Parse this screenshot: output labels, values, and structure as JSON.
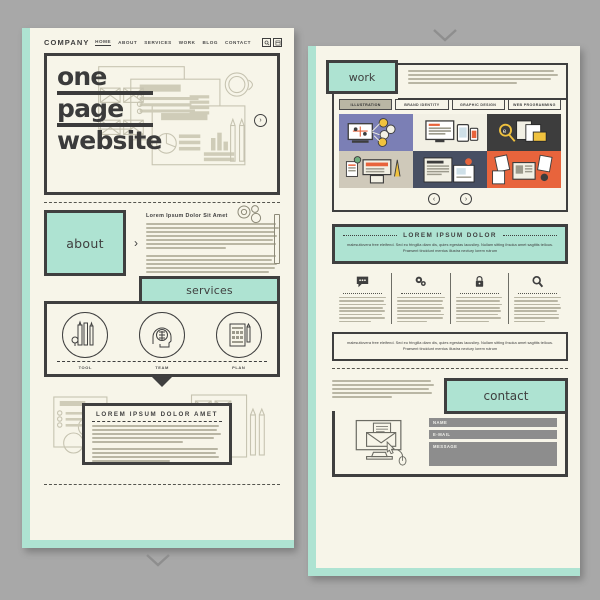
{
  "meta": {
    "bg_color": "#a8a8a8",
    "paper_color": "#f7f5e9",
    "mint_color": "#aee3d2",
    "ink_color": "#3f3f3f"
  },
  "left_page": {
    "header": {
      "brand": "COMPANY",
      "nav": [
        {
          "label": "HOME",
          "active": true
        },
        {
          "label": "ABOUT",
          "active": false
        },
        {
          "label": "SERVICES",
          "active": false
        },
        {
          "label": "WORK",
          "active": false
        },
        {
          "label": "BLOG",
          "active": false
        },
        {
          "label": "CONTACT",
          "active": false
        }
      ],
      "buttons": [
        "search-icon",
        "menu-icon"
      ]
    },
    "hero": {
      "line1": "one",
      "line2": "page",
      "line3": "website",
      "next_label": "›"
    },
    "about": {
      "tab_label": "about",
      "arrow": "›",
      "heading": "Lorem Ipsum Dolor Sit Amet",
      "paragraph1": "Lorem ipsum dolor sit amet, consectetur adipiscing elit. Donec fringilla rhoncus urna eleifend elementum. Sed eu fringilla diam dis, quam egestas lacus nec sagittis tellus. Praesent tincidunt mentus lectus nunc nunc dolore lorem rutrum. Aliquam suscipit. Curabitur eget porttitor elit eu fringilla diam, quis egestas lacus nec sagittis.",
      "paragraph2": "Lorem ipsum dolor sit amet, consectetur adipiscing elit, Donec fringilla rutrum ut viverra diam. Sed eu fringilla diam dis, quam egestas lacus nec sagittis. Praesent tincidunt mentus lectus nunc quam egestas lacus nec sagittis tellus."
    },
    "services": {
      "tab_label": "services",
      "items": [
        {
          "label": "TOOL",
          "icon": "drafting-tools-icon"
        },
        {
          "label": "TEAM",
          "icon": "brain-head-icon"
        },
        {
          "label": "PLAN",
          "icon": "document-plan-icon"
        }
      ]
    },
    "feature_card": {
      "title": "LOREM IPSUM DOLOR AMET",
      "paragraph1": "Lorem ipsum dolor sit amet, consectetur adipiscing elit. Donec fringilla rhoncus urna eleifend elementum. Sed eu fringilla diam quis egestas lacus nec sagittis tellus. Praesent tincidunt mentus lectus nunc dolor nec sagittis.",
      "paragraph2": "Lorem ipsum dolor sit amet, consectetur adipiscing elit. Donec fringilla rutrum ut viverra diam. Sed eu fringilla diam quis egestas lacus nec sagittis. Praesent tincidunt mentus lectus nunc."
    }
  },
  "right_page": {
    "work": {
      "tab_label": "work",
      "intro": "Lorem ipsum dolor sit amet, consectetur adipiscing elit. Donec fringilla rutrum ut viverra diam eleifend. Sed eu fringilla diam quis egestas lacus nec sagittis tellus. Praesent tincidunt mentus lectus nunc nunc dolore eget porttitor elit eu fringilla diam, quis egestas lacus nec sagittis.",
      "filters": [
        {
          "label": "ILLUSTRATION",
          "active": true
        },
        {
          "label": "BRAND IDENTITY",
          "active": false
        },
        {
          "label": "GRAPHIC DESIGN",
          "active": false
        },
        {
          "label": "WEB PROGRAMMING",
          "active": false
        }
      ],
      "thumbnails": [
        {
          "name": "thumb-global-network",
          "color": "#7b7fb5"
        },
        {
          "name": "thumb-responsive-devices",
          "color": "#f2f0e4"
        },
        {
          "name": "thumb-search-files",
          "color": "#3d3d3d"
        },
        {
          "name": "thumb-workspace-desk",
          "color": "#cfc9ba"
        },
        {
          "name": "thumb-web-layouts",
          "color": "#474f63"
        },
        {
          "name": "thumb-tablet-reading",
          "color": "#e8643c"
        }
      ],
      "prev_label": "‹",
      "next_label": "›"
    },
    "banner": {
      "title": "LOREM IPSUM DOLOR",
      "text": "malesuticvera free eleifend. Sed eu fringilla diam dis, quies egestas lacusliey. Nullam sitting ihsoka amet sagittis tellous. Praesent tincidunt mentus illustra nectury lorem rutrum"
    },
    "features": [
      {
        "icon": "speech-bubble-icon",
        "text": "Lorem ipsum dolor sit amet, consectetur adipiscing elit, Donec fringilla rutrum ut viverra eleifend. Sed eu fringilla diam, quis egestas lacusliey. Nullam sitting ihsoka amet sagittis tellous. Praesent tincidunt."
      },
      {
        "icon": "gears-icon",
        "text": "Lorem ipsum dolor sit amet, consectetur adipiscing elit, Donec fringilla rutrum ut viverra eleifend. Sed eu fringilla diam, quis egestas lacusliey. Nullam sitting ihsoka amet sagittis tellous. Praesent tincidunt."
      },
      {
        "icon": "lock-icon",
        "text": "Lorem ipsum dolor sit amet, consectetur adipiscing elit, Donec fringilla rutrum ut viverra eleifend. Sed eu fringilla diam, quis egestas lacusliey. Nullam sitting ihsoka amet sagittis tellous. Praesent tincidunt."
      },
      {
        "icon": "magnifier-icon",
        "text": "Lorem ipsum dolor sit amet, consectetur adipiscing elit, Donec fringilla rutrum ut viverra eleifend. Sed eu fringilla diam, quis egestas lacusliey. Nullam sitting ihsoka amet sagittis tellous. Praesent tincidunt."
      }
    ],
    "outlined_text": "malesuticvera free eleifend. Sed eu fringilla diam dis, quies egestas lacusliey. Nullam sitting ihsoka amet sagittis tellous. Praesent tincidunt mentus illustra nectury lorem rutrum",
    "contact": {
      "tab_label": "contact",
      "note": "Lorem ipsum dolor sit amet, consectetur adipiscing elit. Donec fringilla rutrum ut viverra eleifend. Sed eu fringilla diam, quis egestas lacus nec sagittis tellus. Praesent tincidunt mentus illustra nectury lorem rutrum. Curabitur eget porttitor elit eu fringilla.",
      "fields": [
        {
          "label": "NAME",
          "kind": "text"
        },
        {
          "label": "E-MAIL",
          "kind": "text"
        },
        {
          "label": "MESSAGE",
          "kind": "textarea"
        }
      ],
      "illustration": "desktop-envelope-icon"
    }
  },
  "decor": {
    "chevron_top": "chevron-down-icon",
    "chevron_bottom": "chevron-down-icon"
  }
}
